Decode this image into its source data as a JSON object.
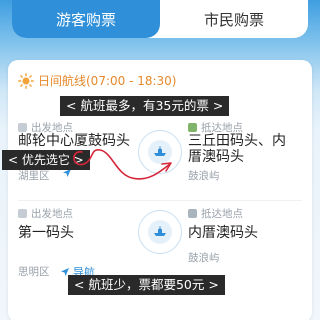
{
  "tabs": [
    {
      "label": "游客购票",
      "active": true
    },
    {
      "label": "市民购票",
      "active": false
    }
  ],
  "route": {
    "title": "日间航线(07:00 - 18:30)",
    "icon": "sun-icon"
  },
  "annotations": {
    "most_trips": "< 航班最多，有35元的票 >",
    "priority": "< 优先选它 >",
    "few_trips": "< 航班少，票都要50元 >"
  },
  "trips": [
    {
      "departure_label": "出发地点",
      "departure_dock": "邮轮中心厦鼓码头",
      "departure_area": "湖里区",
      "arrival_label": "抵达地点",
      "arrival_dock_line1": "三丘田码头、内",
      "arrival_dock_line2": "厝澳码头",
      "arrival_area": "鼓浪屿"
    },
    {
      "departure_label": "出发地点",
      "departure_dock": "第一码头",
      "departure_area": "思明区",
      "nav_label": "导航",
      "arrival_label": "抵达地点",
      "arrival_dock": "内厝澳码头",
      "arrival_area": "鼓浪屿"
    }
  ],
  "colors": {
    "primary": "#2f8fd8",
    "accent_orange": "#e6892b",
    "scribble_red": "#d6263a"
  }
}
